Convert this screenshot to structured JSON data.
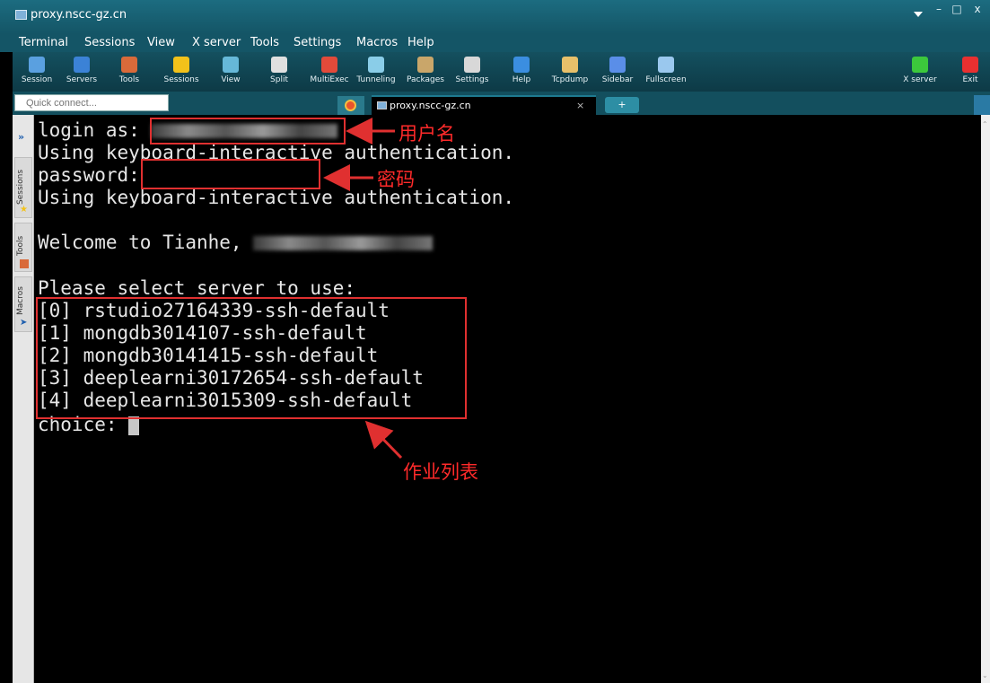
{
  "window": {
    "title": "proxy.nscc-gz.cn",
    "minimize": "–",
    "maximize": "□",
    "close": "x"
  },
  "menu": [
    "Terminal",
    "Sessions",
    "View",
    "X server",
    "Tools",
    "Settings",
    "Macros",
    "Help"
  ],
  "toolbar": {
    "left": [
      {
        "label": "Session",
        "icon": "session-icon",
        "color": "#5aa0e0"
      },
      {
        "label": "Servers",
        "icon": "servers-icon",
        "color": "#3b82d6"
      },
      {
        "label": "Tools",
        "icon": "tools-icon",
        "color": "#d96a3a"
      },
      {
        "label": "Sessions",
        "icon": "star-icon",
        "color": "#f2c21a"
      },
      {
        "label": "View",
        "icon": "view-icon",
        "color": "#66b8d8"
      },
      {
        "label": "Split",
        "icon": "split-icon",
        "color": "#e0e0e0"
      },
      {
        "label": "MultiExec",
        "icon": "multiexec-icon",
        "color": "#e24a3a"
      },
      {
        "label": "Tunneling",
        "icon": "tunneling-icon",
        "color": "#8acde8"
      },
      {
        "label": "Packages",
        "icon": "packages-icon",
        "color": "#c9a66a"
      },
      {
        "label": "Settings",
        "icon": "settings-icon",
        "color": "#d8d8d8"
      },
      {
        "label": "Help",
        "icon": "help-icon",
        "color": "#3b8ee0"
      },
      {
        "label": "Tcpdump",
        "icon": "tcpdump-icon",
        "color": "#e8c06a"
      },
      {
        "label": "Sidebar",
        "icon": "sidebar-icon",
        "color": "#5a8ee8"
      },
      {
        "label": "Fullscreen",
        "icon": "fullscreen-icon",
        "color": "#9ac8ee"
      }
    ],
    "right": [
      {
        "label": "X server",
        "icon": "x-server-icon",
        "color": "#3cc83c"
      },
      {
        "label": "Exit",
        "icon": "exit-icon",
        "color": "#e83030"
      }
    ]
  },
  "tabs": {
    "quick_connect_placeholder": "Quick connect...",
    "active_label": "proxy.nscc-gz.cn",
    "close": "×",
    "plus": "+"
  },
  "sidepanel": {
    "chevron": "»",
    "tabs": [
      "Sessions",
      "Tools",
      "Macros"
    ]
  },
  "terminal": {
    "login_prompt": "login as: ",
    "auth1": "Using keyboard-interactive authentication.",
    "password_prompt": "password: ",
    "auth2": "Using keyboard-interactive authentication.",
    "welcome": "Welcome to Tianhe, ",
    "select_prompt": "Please select server to use:",
    "servers": [
      "[0] rstudio27164339-ssh-default",
      "[1] mongdb3014107-ssh-default",
      "[2] mongdb30141415-ssh-default",
      "[3] deeplearni30172654-ssh-default",
      "[4] deeplearni3015309-ssh-default"
    ],
    "choice_prompt": "choice: "
  },
  "annotations": {
    "username": "用户名",
    "password": "密码",
    "job_list": "作业列表",
    "color": "#e03030"
  }
}
